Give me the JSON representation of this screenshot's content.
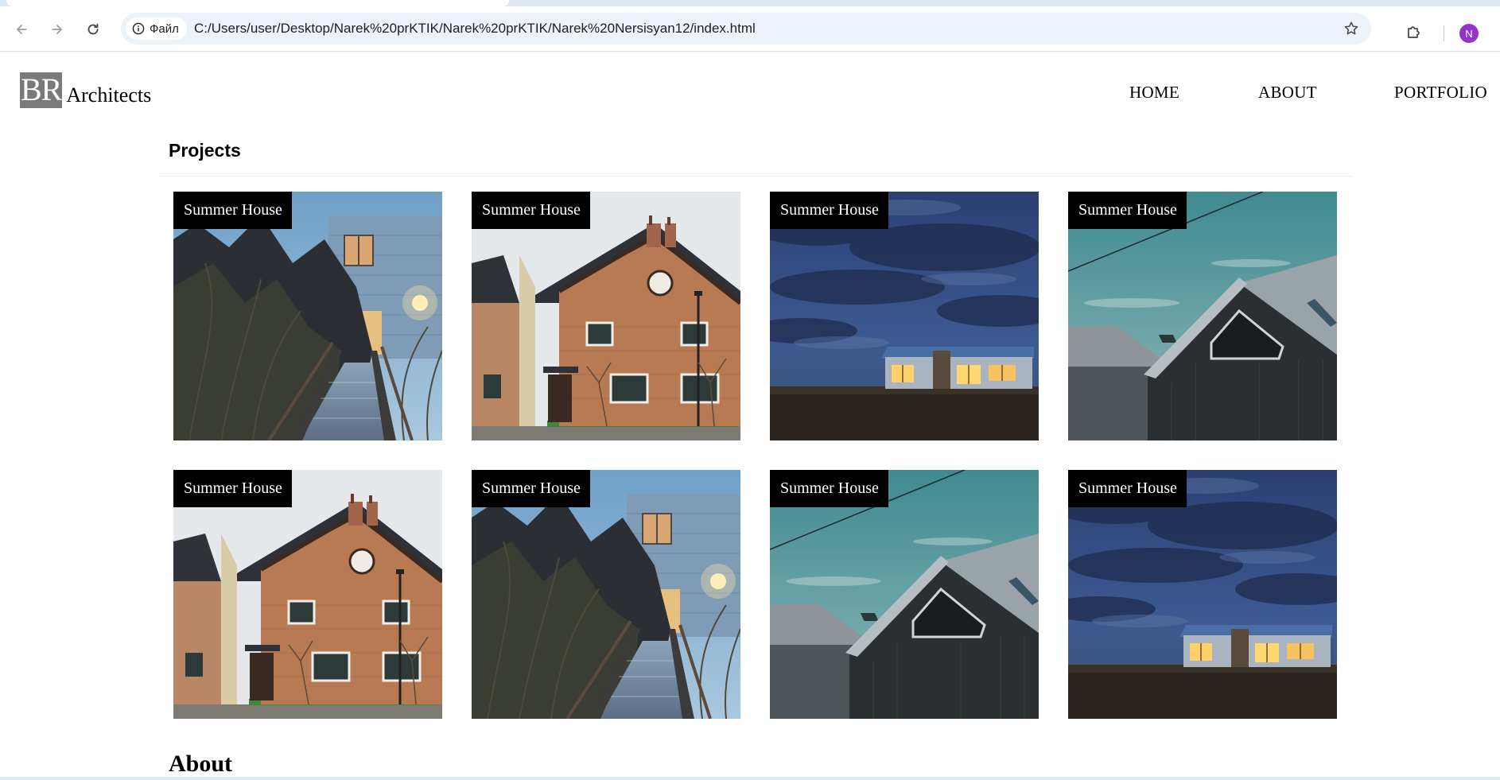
{
  "browser": {
    "site_info_label": "Файл",
    "url": "C:/Users/user/Desktop/Narek%20prKTIK/Narek%20prKTIK/Narek%20Nersisyan12/index.html",
    "profile_initial": "N",
    "profile_color": "#9334c9"
  },
  "site": {
    "logo_mark": "BR",
    "logo_text": "Architects",
    "nav": [
      {
        "label": "HOME"
      },
      {
        "label": "ABOUT"
      },
      {
        "label": "PORTFOLIO"
      }
    ]
  },
  "projects": {
    "title": "Projects",
    "items": [
      {
        "label": "Summer House",
        "photo": "boardwalk-house"
      },
      {
        "label": "Summer House",
        "photo": "brick-house"
      },
      {
        "label": "Summer House",
        "photo": "night-bungalow"
      },
      {
        "label": "Summer House",
        "photo": "dark-gable-house"
      },
      {
        "label": "Summer House",
        "photo": "brick-house"
      },
      {
        "label": "Summer House",
        "photo": "boardwalk-house"
      },
      {
        "label": "Summer House",
        "photo": "dark-gable-house"
      },
      {
        "label": "Summer House",
        "photo": "night-bungalow"
      }
    ]
  },
  "about": {
    "title": "About"
  }
}
